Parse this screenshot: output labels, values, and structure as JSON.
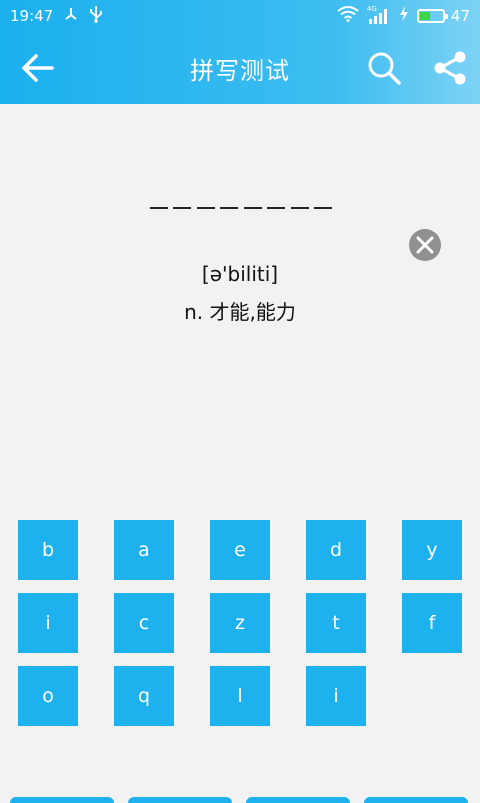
{
  "status_bar": {
    "time": "19:47",
    "network": "4G",
    "battery": "47",
    "battery_level": 0.47
  },
  "app_bar": {
    "title": "拼写测试"
  },
  "quiz": {
    "blank_count": 8,
    "phonetic": "[ə'biliti]",
    "meaning": "n. 才能,能力"
  },
  "keyboard": {
    "keys": [
      "b",
      "a",
      "e",
      "d",
      "y",
      "i",
      "c",
      "z",
      "t",
      "f",
      "o",
      "q",
      "l",
      "i"
    ]
  },
  "colors": {
    "accent": "#1db2ee",
    "background": "#f2f2f2",
    "clear_button": "#909090"
  }
}
